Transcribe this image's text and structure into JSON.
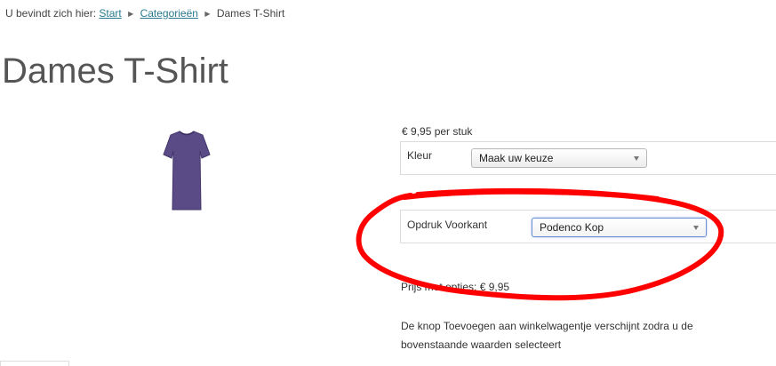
{
  "breadcrumb": {
    "prefix": "U bevindt zich hier:",
    "items": [
      {
        "label": "Start"
      },
      {
        "label": "Categorieën"
      },
      {
        "label": "Dames T-Shirt"
      }
    ]
  },
  "product": {
    "title": "Dames T-Shirt",
    "image_color": "#5a4a85",
    "price_per_unit": "€ 9,95 per stuk"
  },
  "options": [
    {
      "label": "Kleur",
      "selected": "Maak uw keuze"
    },
    {
      "label": "Opdruk Voorkant",
      "selected": "Podenco Kop"
    }
  ],
  "total": {
    "text": "Prijs met opties: € 9,95"
  },
  "notice": "De knop Toevoegen aan winkelwagentje verschijnt zodra u de bovenstaande waarden selecteert",
  "colors": {
    "link": "#2a7a8f",
    "annotation": "#ff0000"
  }
}
